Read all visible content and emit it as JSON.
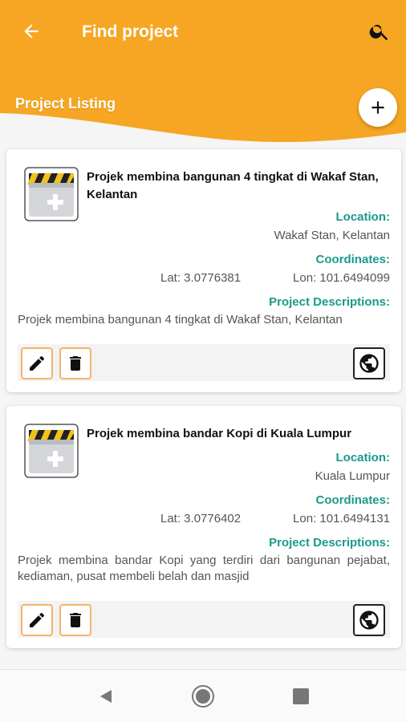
{
  "app_bar": {
    "title": "Find project"
  },
  "header": {
    "listing_title": "Project Listing"
  },
  "colors": {
    "accent": "#f6a623",
    "label_teal": "#1a9a8c",
    "action_border": "#f3b46a"
  },
  "labels": {
    "location": "Location:",
    "coordinates": "Coordinates:",
    "descriptions": "Project Descriptions:"
  },
  "projects": [
    {
      "title": "Projek membina bangunan 4 tingkat di Wakaf Stan, Kelantan",
      "location": "Wakaf Stan, Kelantan",
      "lat": "Lat: 3.0776381",
      "lon": "Lon: 101.6494099",
      "description": "Projek membina bangunan 4 tingkat di Wakaf Stan, Kelantan"
    },
    {
      "title": "Projek membina bandar Kopi di Kuala Lumpur",
      "location": "Kuala Lumpur",
      "lat": "Lat: 3.0776402",
      "lon": "Lon: 101.6494131",
      "description": "Projek membina bandar Kopi yang terdiri dari bangunan pejabat, kediaman, pusat membeli belah dan masjid"
    }
  ],
  "icons": [
    "back-arrow-icon",
    "search-icon",
    "plus-icon",
    "folder-icon",
    "pencil-icon",
    "trash-icon",
    "globe-icon",
    "nav-back-icon",
    "nav-home-icon",
    "nav-recents-icon"
  ]
}
